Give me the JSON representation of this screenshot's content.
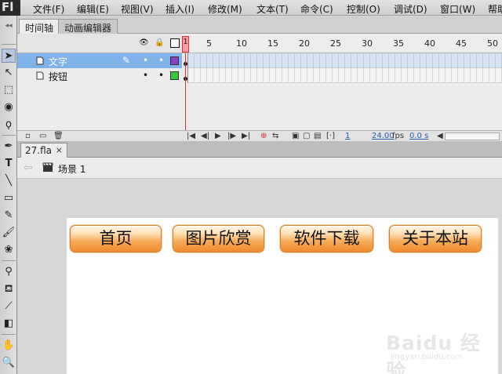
{
  "app": {
    "logo": "Fl"
  },
  "menu": [
    "文件(F)",
    "编辑(E)",
    "视图(V)",
    "插入(I)",
    "修改(M)",
    "文本(T)",
    "命令(C)",
    "控制(O)",
    "调试(D)",
    "窗口(W)",
    "帮助"
  ],
  "timeline": {
    "tabs": [
      "时间轴",
      "动画编辑器"
    ],
    "ruler": [
      "1",
      "5",
      "10",
      "15",
      "20",
      "25",
      "30",
      "35",
      "40",
      "45",
      "50"
    ],
    "layers": [
      {
        "name": "文字",
        "selected": true,
        "color": "#8a3fc7"
      },
      {
        "name": "按钮",
        "selected": false,
        "color": "#33cc33"
      }
    ],
    "status": {
      "frame": "1",
      "fps": "24.00",
      "fps_unit": "fps",
      "time": "0.0 s"
    }
  },
  "document": {
    "tab": "27.fla",
    "close": "×"
  },
  "scene": {
    "label": "场景 1"
  },
  "stage": {
    "buttons": [
      "首页",
      "图片欣赏",
      "软件下载",
      "关于本站"
    ]
  },
  "watermark": {
    "text": "Baidu 经验",
    "sub": "jingyan.baidu.com"
  }
}
